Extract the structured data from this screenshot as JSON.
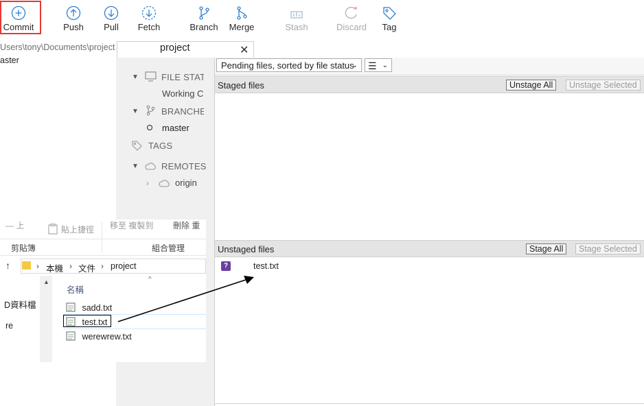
{
  "toolbar": {
    "buttons": [
      {
        "id": "commit",
        "label": "Commit",
        "icon": "plus-circle-icon",
        "enabled": true
      },
      {
        "id": "push",
        "label": "Push",
        "icon": "arrow-up-circle-icon",
        "enabled": true
      },
      {
        "id": "pull",
        "label": "Pull",
        "icon": "arrow-down-circle-icon",
        "enabled": true
      },
      {
        "id": "fetch",
        "label": "Fetch",
        "icon": "dashed-arrow-down-circle-icon",
        "enabled": true
      },
      {
        "id": "branch",
        "label": "Branch",
        "icon": "branch-icon",
        "enabled": true
      },
      {
        "id": "merge",
        "label": "Merge",
        "icon": "merge-icon",
        "enabled": true
      },
      {
        "id": "stash",
        "label": "Stash",
        "icon": "stash-icon",
        "enabled": false
      },
      {
        "id": "discard",
        "label": "Discard",
        "icon": "discard-icon",
        "enabled": false
      },
      {
        "id": "tag",
        "label": "Tag",
        "icon": "tag-icon",
        "enabled": true
      }
    ],
    "highlight_color": "#e53935"
  },
  "repo_path": "Users\\tony\\Documents\\project",
  "current_branch_left": "aster",
  "tab": {
    "title": "project"
  },
  "sidebar": {
    "file_status": "FILE STATUS",
    "working_copy": "Working Copy",
    "branches": "BRANCHES",
    "branch_master": "master",
    "tags": "TAGS",
    "remotes": "REMOTES",
    "remote_origin": "origin"
  },
  "filter": {
    "sort_label": "Pending files, sorted by file status",
    "view_icon": "list-view-icon"
  },
  "staged": {
    "title": "Staged files",
    "unstage_all": "Unstage All",
    "unstage_selected": "Unstage Selected"
  },
  "unstaged": {
    "title": "Unstaged files",
    "stage_all": "Stage All",
    "stage_selected": "Stage Selected",
    "files": [
      {
        "name": "test.txt",
        "status_icon": "question-mark-icon"
      }
    ],
    "status_color": "#6b3fa0"
  },
  "explorer": {
    "ribbon_faint": [
      "貼上捷徑"
    ],
    "group_clipboard": "剪貼簿",
    "group_organize": "組合管理",
    "breadcrumb": [
      "本機",
      "文件",
      "project"
    ],
    "column_name": "名稱",
    "files": [
      "sadd.txt",
      "test.txt",
      "werewrew.txt"
    ],
    "left_nav": [
      "D資料檔",
      "re"
    ]
  }
}
